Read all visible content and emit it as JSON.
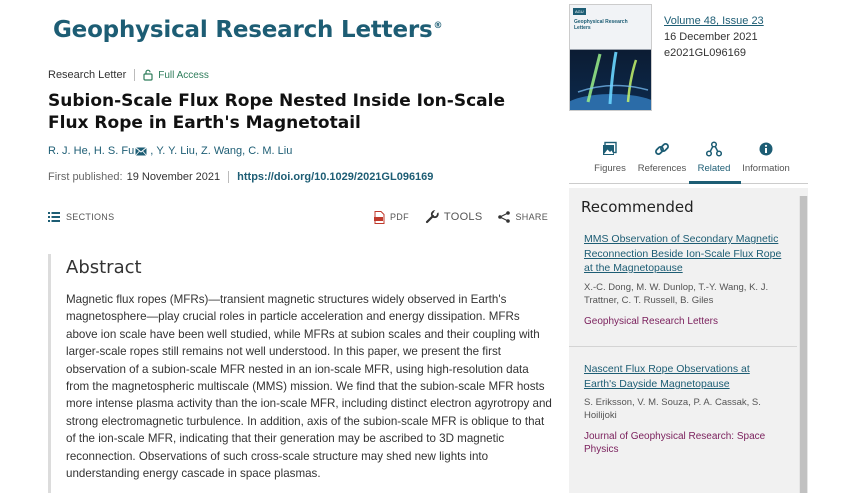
{
  "journal": {
    "name": "Geophysical Research Letters",
    "mark": "®"
  },
  "article": {
    "type": "Research Letter",
    "access": "Full Access",
    "title": "Subion-Scale Flux Rope Nested Inside Ion-Scale Flux Rope in Earth's Magnetotail",
    "authors": [
      "R. J. He",
      "H. S. Fu",
      "Y. Y. Liu",
      "Z. Wang",
      "C. M. Liu"
    ],
    "published_label": "First published:",
    "published_date": "19 November 2021",
    "doi": "https://doi.org/10.1029/2021GL096169"
  },
  "toolbar": {
    "sections": "SECTIONS",
    "pdf": "PDF",
    "tools": "TOOLS",
    "share": "SHARE"
  },
  "abstract": {
    "heading": "Abstract",
    "text": "Magnetic flux ropes (MFRs)—transient magnetic structures widely observed in Earth's magnetosphere—play crucial roles in particle acceleration and energy dissipation. MFRs above ion scale have been well studied, while MFRs at subion scales and their coupling with larger-scale ropes still remains not well understood. In this paper, we present the first observation of a subion-scale MFR nested in an ion-scale MFR, using high-resolution data from the magnetospheric multiscale (MMS) mission. We find that the subion-scale MFR hosts more intense plasma activity than the ion-scale MFR, including distinct electron agyrotropy and strong electromagnetic turbulence. In addition, axis of the subion-scale MFR is oblique to that of the ion-scale MFR, indicating that their generation may be ascribed to 3D magnetic reconnection. Observations of such cross-scale structure may shed new lights into understanding energy cascade in space plasmas."
  },
  "issue": {
    "cover_agu": "AGU",
    "cover_title": "Geophysical Research Letters",
    "volume_issue": "Volume 48, Issue 23",
    "date": "16 December 2021",
    "article_number": "e2021GL096169"
  },
  "tabs": [
    {
      "label": "Figures",
      "icon": "image-icon"
    },
    {
      "label": "References",
      "icon": "link-icon"
    },
    {
      "label": "Related",
      "icon": "network-icon",
      "active": true
    },
    {
      "label": "Information",
      "icon": "info-icon"
    }
  ],
  "recommended": {
    "heading": "Recommended",
    "items": [
      {
        "title": "MMS Observation of Secondary Magnetic Reconnection Beside Ion-Scale Flux Rope at the Magnetopause",
        "authors": "X.-C. Dong, M. W. Dunlop, T.-Y. Wang, K. J. Trattner, C. T. Russell, B. Giles",
        "journal": "Geophysical Research Letters"
      },
      {
        "title": "Nascent Flux Rope Observations at Earth's Dayside Magnetopause",
        "authors": "S. Eriksson, V. M. Souza, P. A. Cassak, S. Hoilijoki",
        "journal": "Journal of Geophysical Research: Space Physics"
      }
    ]
  },
  "colors": {
    "brand": "#1d5d74",
    "journal_link": "#7a1f5c",
    "access_green": "#2e7d5b"
  }
}
